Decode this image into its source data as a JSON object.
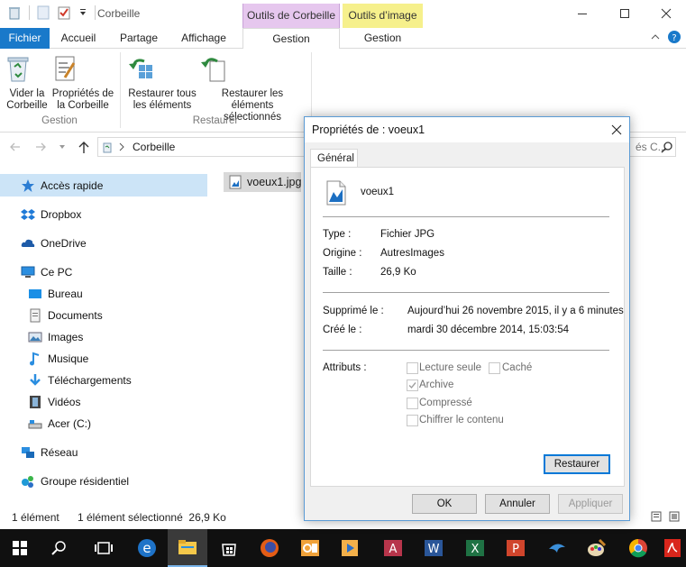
{
  "window": {
    "title": "Corbeille",
    "contextual_tabs": [
      "Outils de Corbeille",
      "Outils d’image"
    ]
  },
  "ribbon": {
    "tabs": [
      "Fichier",
      "Accueil",
      "Partage",
      "Affichage",
      "Gestion",
      "Gestion"
    ],
    "buttons": [
      {
        "label1": "Vider la",
        "label2": "Corbeille",
        "icon": "recycle-bin-icon"
      },
      {
        "label1": "Propriétés de",
        "label2": "la Corbeille",
        "icon": "properties-icon"
      },
      {
        "label1": "Restaurer tous",
        "label2": "les éléments",
        "icon": "restore-all-icon"
      },
      {
        "label1": "Restaurer les éléments",
        "label2": "sélectionnés",
        "icon": "restore-selected-icon"
      }
    ],
    "groups": [
      "Gestion",
      "Restaurer"
    ]
  },
  "address": {
    "path": "Corbeille",
    "search_placeholder": "és C..."
  },
  "nav": {
    "items": [
      {
        "label": "Accès rapide",
        "icon": "star-icon"
      },
      {
        "label": "Dropbox",
        "icon": "dropbox-icon"
      },
      {
        "label": "OneDrive",
        "icon": "cloud-icon"
      },
      {
        "label": "Ce PC",
        "icon": "computer-icon"
      },
      {
        "label": "Bureau",
        "icon": "desktop-icon"
      },
      {
        "label": "Documents",
        "icon": "documents-icon"
      },
      {
        "label": "Images",
        "icon": "pictures-icon"
      },
      {
        "label": "Musique",
        "icon": "music-icon"
      },
      {
        "label": "Téléchargements",
        "icon": "downloads-icon"
      },
      {
        "label": "Vidéos",
        "icon": "videos-icon"
      },
      {
        "label": "Acer (C:)",
        "icon": "drive-icon"
      },
      {
        "label": "Réseau",
        "icon": "network-icon"
      },
      {
        "label": "Groupe résidentiel",
        "icon": "homegroup-icon"
      }
    ]
  },
  "files": [
    {
      "name": "voeux1.jpg"
    }
  ],
  "status": {
    "count": "1 élément",
    "selection": "1 élément sélectionné  26,9 Ko"
  },
  "dialog": {
    "title": "Propriétés de : voeux1",
    "tab": "Général",
    "filename": "voeux1",
    "rows": [
      {
        "label": "Type :",
        "value": "Fichier JPG"
      },
      {
        "label": "Origine :",
        "value": "AutresImages"
      },
      {
        "label": "Taille :",
        "value": "26,9 Ko"
      }
    ],
    "dates": [
      {
        "label": "Supprimé le :",
        "value": "Aujourd’hui 26 novembre 2015, il y a 6 minutes"
      },
      {
        "label": "Créé le :",
        "value": "mardi 30 décembre 2014, 15:03:54"
      }
    ],
    "attributes_label": "Attributs :",
    "attributes": [
      {
        "label": "Lecture seule",
        "checked": false
      },
      {
        "label": "Caché",
        "checked": false
      },
      {
        "label": "Archive",
        "checked": true
      },
      {
        "label": "Compressé",
        "checked": false
      },
      {
        "label": "Chiffrer le contenu",
        "checked": false
      }
    ],
    "restore_button": "Restaurer",
    "ok_button": "OK",
    "cancel_button": "Annuler",
    "apply_button": "Appliquer"
  },
  "taskbar": {
    "icons": [
      "windows-start-icon",
      "search-icon",
      "task-view-icon",
      "edge-icon",
      "file-explorer-icon",
      "store-icon",
      "firefox-icon",
      "outlook-icon",
      "media-player-icon",
      "access-icon",
      "word-icon",
      "excel-icon",
      "powerpoint-icon",
      "bird-app-icon",
      "paint-icon",
      "chrome-icon",
      "acrobat-icon"
    ]
  },
  "colors": {
    "accent": "#1979ca",
    "ctx_recycle": "#e6c7ee",
    "ctx_image": "#f6f08c",
    "nav_selected": "#cce4f7",
    "taskbar": "#101010"
  }
}
